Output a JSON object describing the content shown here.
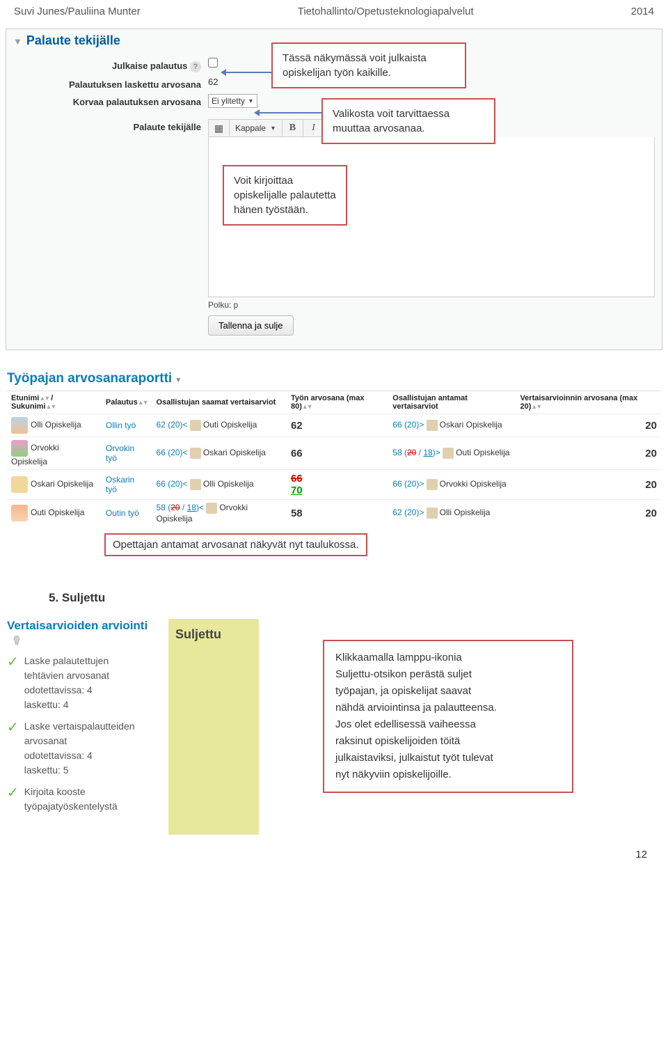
{
  "header": {
    "left": "Suvi Junes/Pauliina Munter",
    "mid": "Tietohallinto/Opetusteknologiapalvelut",
    "right": "2014"
  },
  "panel": {
    "title": "Palaute tekijälle",
    "rows": {
      "publish": {
        "label": "Julkaise palautus"
      },
      "calculated": {
        "label": "Palautuksen laskettu arvosana",
        "value": "62"
      },
      "override": {
        "label": "Korvaa palautuksen arvosana",
        "select": "Ei ylitetty"
      },
      "feedback": {
        "label": "Palaute tekijälle",
        "paragraph": "Kappale"
      }
    },
    "path": "Polku: p",
    "save": "Tallenna ja sulje"
  },
  "callouts": {
    "c1": {
      "l1": "Tässä näkymässä voit julkaista",
      "l2": "opiskelijan työn kaikille."
    },
    "c2": {
      "l1": "Valikosta voit tarvittaessa",
      "l2": "muuttaa arvosanaa."
    },
    "c3": {
      "l1": "Voit kirjoittaa",
      "l2": "opiskelijalle palautetta",
      "l3": "hänen työstään."
    },
    "c4": "Opettajan antamat arvosanat näkyvät nyt taulukossa."
  },
  "report": {
    "title": "Työpajan arvosanaraportti",
    "headers": {
      "name": "Etunimi",
      "nameSep": "/",
      "surname": "Sukunimi",
      "sub": "Palautus",
      "received": "Osallistujan saamat vertaisarviot",
      "grade": "Työn arvosana (max 80)",
      "given": "Osallistujan antamat vertaisarviot",
      "peer": "Vertaisarvioinnin arvosana (max 20)"
    },
    "rows": [
      {
        "first": "Olli Opiskelija",
        "work": "Ollin työ",
        "rec": "62 (20)<",
        "recName": "Outi Opiskelija",
        "g": "62",
        "g2": "",
        "giv": "66 (20)>",
        "givName": "Oskari Opiskelija",
        "p": "20"
      },
      {
        "first": "Orvokki Opiskelija",
        "work": "Orvokin työ",
        "rec": "66 (20)<",
        "recName": "Oskari Opiskelija",
        "g": "66",
        "g2": "",
        "giv": "58 (20 / 18)>",
        "givName": "Outi Opiskelija",
        "givStrike": "58 (20",
        "p": "20"
      },
      {
        "first": "Oskari Opiskelija",
        "work": "Oskarin työ",
        "rec": "66 (20)<",
        "recName": "Olli Opiskelija",
        "g": "66",
        "gStrike": true,
        "g2": "70",
        "giv": "66 (20)>",
        "givName": "Orvokki Opiskelija",
        "p": "20"
      },
      {
        "first": "Outi Opiskelija",
        "work": "Outin työ",
        "rec": "58 (20 / 18)<",
        "recName": "Orvokki Opiskelija",
        "recStrike": "58 (20",
        "g": "58",
        "g2": "",
        "giv": "62 (20)>",
        "givName": "Olli Opiskelija",
        "p": "20"
      }
    ]
  },
  "s5": {
    "title": "5. Suljettu"
  },
  "eval": {
    "title": "Vertaisarvioiden arviointi",
    "i1": {
      "a": "Laske palautettujen",
      "b": "tehtävien arvosanat",
      "c": "odotettavissa: 4",
      "d": "laskettu: 4"
    },
    "i2": {
      "a": "Laske vertaispalautteiden",
      "b": "arvosanat",
      "c": "odotettavissa: 4",
      "d": "laskettu: 5"
    },
    "i3": {
      "a": "Kirjoita kooste",
      "b": "työpajatyöskentelystä"
    }
  },
  "suljettu": "Suljettu",
  "bcall": {
    "l1": "Klikkaamalla lamppu-ikonia",
    "l2": "Suljettu-otsikon perästä suljet",
    "l3": "työpajan, ja opiskelijat saavat",
    "l4": "nähdä arviointinsa ja palautteensa.",
    "l5": "Jos olet edellisessä vaiheessa",
    "l6": "raksinut opiskelijoiden töitä",
    "l7": "julkaistaviksi, julkaistut työt tulevat",
    "l8": "nyt näkyviin opiskelijoille."
  },
  "pagenum": "12"
}
